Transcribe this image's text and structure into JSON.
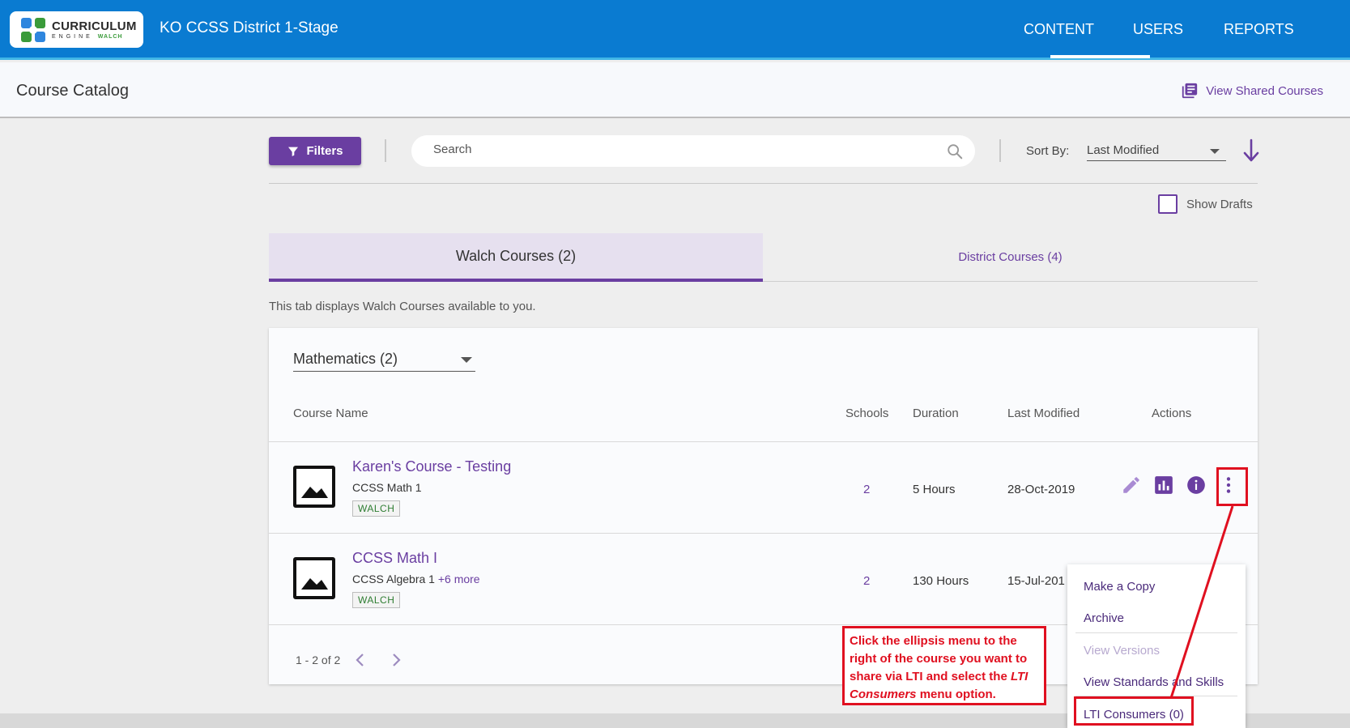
{
  "header": {
    "logo": {
      "line1": "CURRICULUM",
      "line2": "ENGINE",
      "line2b": "WALCH"
    },
    "district": "KO CCSS District 1-Stage",
    "nav": [
      {
        "label": "CONTENT",
        "active": true
      },
      {
        "label": "USERS",
        "active": false
      },
      {
        "label": "REPORTS",
        "active": false
      }
    ]
  },
  "subheader": {
    "title": "Course Catalog",
    "shared_link": "View Shared Courses",
    "shared_icon": "library-books-icon"
  },
  "toolbar": {
    "filters_label": "Filters",
    "search_placeholder": "Search",
    "sort_label": "Sort By:",
    "sort_value": "Last Modified",
    "show_drafts_label": "Show Drafts",
    "show_drafts_checked": false
  },
  "tabs": [
    {
      "label": "Walch Courses (2)",
      "active": true
    },
    {
      "label": "District Courses (4)",
      "active": false
    }
  ],
  "tab_description": "This tab displays Walch Courses available to you.",
  "subject_select": "Mathematics (2)",
  "table": {
    "headers": [
      "Course Name",
      "Schools",
      "Duration",
      "Last Modified",
      "Actions"
    ],
    "rows": [
      {
        "name": "Karen's Course - Testing",
        "subtitle": "CCSS Math 1",
        "more": "",
        "tag": "WALCH",
        "schools": "2",
        "duration": "5 Hours",
        "modified": "28-Oct-2019"
      },
      {
        "name": "CCSS Math I",
        "subtitle": "CCSS Algebra 1",
        "more": "+6 more",
        "tag": "WALCH",
        "schools": "2",
        "duration": "130 Hours",
        "modified": "15-Jul-201"
      }
    ],
    "pager": "1 - 2 of 2"
  },
  "context_menu": {
    "items": [
      {
        "label": "Make a Copy",
        "disabled": false
      },
      {
        "label": "Archive",
        "disabled": false
      },
      {
        "label": "View Versions",
        "disabled": true
      },
      {
        "label": "View Standards and Skills",
        "disabled": false
      },
      {
        "label": "LTI Consumers (0)",
        "disabled": false
      }
    ]
  },
  "annotation": {
    "text_before": "Click the ellipsis menu to the right of the course you want to share via LTI and select the ",
    "text_italic": "LTI Consumers",
    "text_after": " menu option."
  },
  "colors": {
    "header_blue": "#0a7bd1",
    "accent_purple": "#6a3ea1",
    "annotation_red": "#e01020",
    "tag_green": "#2e7d32"
  }
}
